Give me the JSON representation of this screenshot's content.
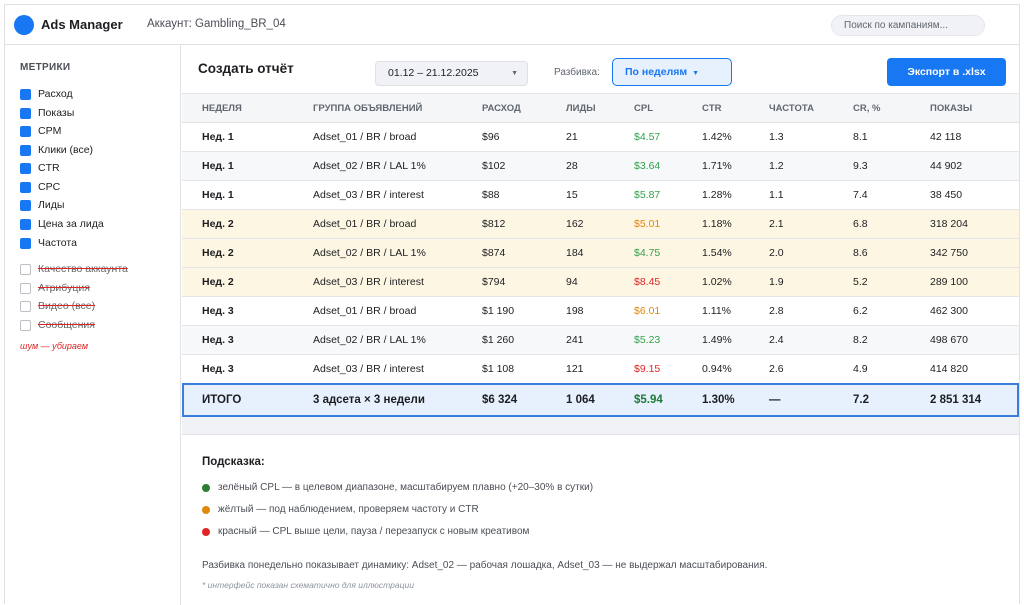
{
  "app": {
    "title": "Ads Manager",
    "account": "Аккаунт: Gambling_BR_04"
  },
  "search": {
    "placeholder": "Поиск по кампаниям..."
  },
  "sidebar": {
    "title": "МЕТРИКИ",
    "metrics_on": [
      {
        "label": "Расход"
      },
      {
        "label": "Показы"
      },
      {
        "label": "CPM"
      },
      {
        "label": "Клики (все)"
      },
      {
        "label": "CTR"
      },
      {
        "label": "CPC"
      },
      {
        "label": "Лиды"
      },
      {
        "label": "Цена за лида"
      },
      {
        "label": "Частота"
      }
    ],
    "metrics_off": [
      {
        "label": "Качество аккаунта"
      },
      {
        "label": "Атрибуция"
      },
      {
        "label": "Видео (все)"
      },
      {
        "label": "Сообщения"
      }
    ],
    "noise_note": "шум — убираем"
  },
  "toolbar": {
    "title": "Создать отчёт",
    "date_range": "01.12 – 21.12.2025",
    "split_label": "Разбивка:",
    "split_value": "По неделям",
    "export_label": "Экспорт в .xlsx"
  },
  "table": {
    "headers": [
      "НЕДЕЛЯ",
      "ГРУППА ОБЪЯВЛЕНИЙ",
      "РАСХОД",
      "ЛИДЫ",
      "CPL",
      "CTR",
      "ЧАСТОТА",
      "CR, %",
      "ПОКАЗЫ"
    ],
    "rows": [
      {
        "week": "Нед. 1",
        "adset": "Adset_01 / BR / broad",
        "spend": "$96",
        "leads": "21",
        "cpl": "$4.57",
        "cpl_status": "green",
        "ctr": "1.42%",
        "freq": "1.3",
        "cr": "8.1",
        "impr": "42 118"
      },
      {
        "week": "Нед. 1",
        "adset": "Adset_02 / BR / LAL 1%",
        "spend": "$102",
        "leads": "28",
        "cpl": "$3.64",
        "cpl_status": "green",
        "ctr": "1.71%",
        "freq": "1.2",
        "cr": "9.3",
        "impr": "44 902"
      },
      {
        "week": "Нед. 1",
        "adset": "Adset_03 / BR / interest",
        "spend": "$88",
        "leads": "15",
        "cpl": "$5.87",
        "cpl_status": "green",
        "ctr": "1.28%",
        "freq": "1.1",
        "cr": "7.4",
        "impr": "38 450"
      },
      {
        "week": "Нед. 2",
        "adset": "Adset_01 / BR / broad",
        "spend": "$812",
        "leads": "162",
        "cpl": "$5.01",
        "cpl_status": "orange",
        "ctr": "1.18%",
        "freq": "2.1",
        "cr": "6.8",
        "impr": "318 204"
      },
      {
        "week": "Нед. 2",
        "adset": "Adset_02 / BR / LAL 1%",
        "spend": "$874",
        "leads": "184",
        "cpl": "$4.75",
        "cpl_status": "green",
        "ctr": "1.54%",
        "freq": "2.0",
        "cr": "8.6",
        "impr": "342 750"
      },
      {
        "week": "Нед. 2",
        "adset": "Adset_03 / BR / interest",
        "spend": "$794",
        "leads": "94",
        "cpl": "$8.45",
        "cpl_status": "red",
        "ctr": "1.02%",
        "freq": "1.9",
        "cr": "5.2",
        "impr": "289 100"
      },
      {
        "week": "Нед. 3",
        "adset": "Adset_01 / BR / broad",
        "spend": "$1 190",
        "leads": "198",
        "cpl": "$6.01",
        "cpl_status": "orange",
        "ctr": "1.11%",
        "freq": "2.8",
        "cr": "6.2",
        "impr": "462 300"
      },
      {
        "week": "Нед. 3",
        "adset": "Adset_02 / BR / LAL 1%",
        "spend": "$1 260",
        "leads": "241",
        "cpl": "$5.23",
        "cpl_status": "green",
        "ctr": "1.49%",
        "freq": "2.4",
        "cr": "8.2",
        "impr": "498 670"
      },
      {
        "week": "Нед. 3",
        "adset": "Adset_03 / BR / interest",
        "spend": "$1 108",
        "leads": "121",
        "cpl": "$9.15",
        "cpl_status": "red",
        "ctr": "0.94%",
        "freq": "2.6",
        "cr": "4.9",
        "impr": "414 820"
      }
    ],
    "total": {
      "week": "ИТОГО",
      "adset": "3 адсета × 3 недели",
      "spend": "$6 324",
      "leads": "1 064",
      "cpl": "$5.94",
      "ctr": "1.30%",
      "freq": "—",
      "cr": "7.2",
      "impr": "2 851 314"
    }
  },
  "hint": {
    "title": "Подсказка:",
    "items": [
      {
        "color": "#2e7d32",
        "text": "зелёный CPL — в целевом диапазоне, масштабируем плавно (+20–30% в сутки)"
      },
      {
        "color": "#e0870e",
        "text": "жёлтый — под наблюдением, проверяем частоту и CTR"
      },
      {
        "color": "#e02424",
        "text": "красный — CPL выше цели, пауза / перезапуск с новым креативом"
      }
    ],
    "note": "Разбивка понедельно показывает динамику: Adset_02 — рабочая лошадка, Adset_03 — не выдержал масштабирования.",
    "footnote": "* интерфейс показан схематично для иллюстрации"
  },
  "colors": {
    "accent": "#1877f2",
    "green": "#31a24c",
    "orange": "#e0870e",
    "red": "#e02424",
    "week2_bg": "#fdf6e3",
    "total_bg": "#e7f0fd"
  }
}
